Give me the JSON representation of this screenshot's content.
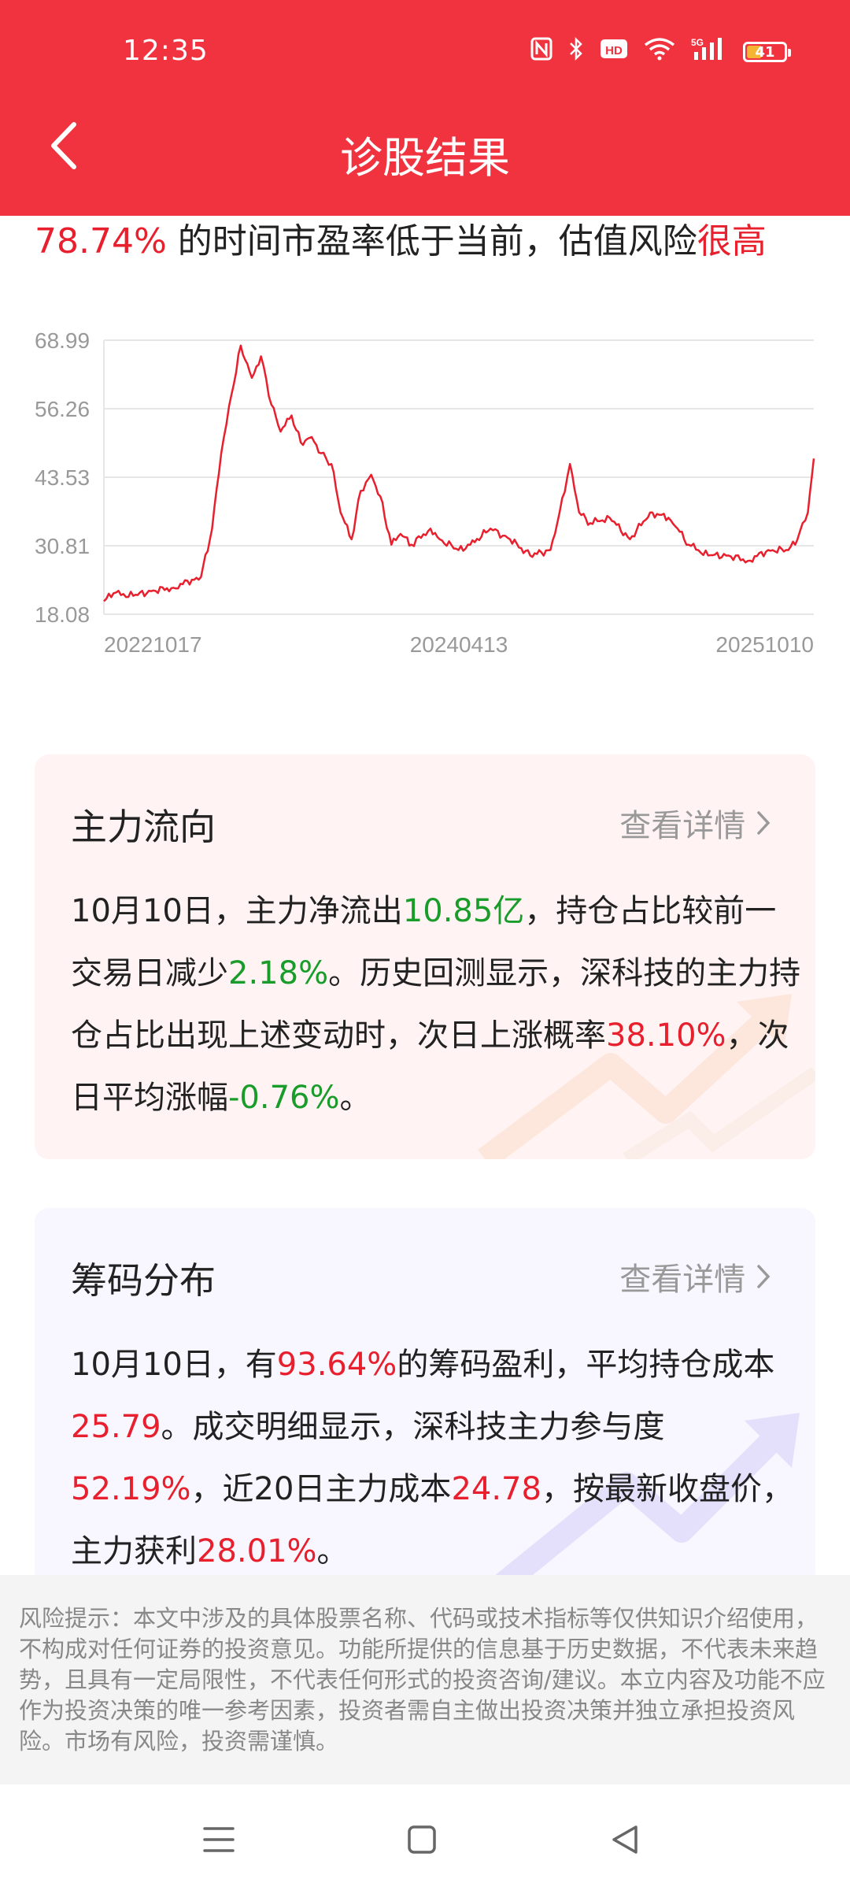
{
  "status_bar": {
    "time": "12:35",
    "icons": [
      "nfc-icon",
      "bluetooth-icon",
      "hd-icon",
      "wifi-icon",
      "5g-signal-icon",
      "battery-icon"
    ],
    "hd_label": "HD",
    "network_label": "5G",
    "battery_level": "41",
    "battery_fraction": 0.41,
    "battery_color": "#f5b431"
  },
  "header": {
    "title": "诊股结果",
    "background_color": "#f0333f"
  },
  "summary": {
    "percent": "78.74%",
    "text": " 的时间市盈率低于当前，估值风险",
    "risk_level": "很高"
  },
  "chart_data": {
    "type": "line",
    "yticks": [
      "68.99",
      "56.26",
      "43.53",
      "30.81",
      "18.08"
    ],
    "ylim": [
      18.08,
      68.99
    ],
    "xticks": [
      "20221017",
      "20240413",
      "20251010"
    ],
    "grid": true,
    "line_color": "#e8202e",
    "series": [
      {
        "x": [
          "20221017",
          "20221101",
          "20221201",
          "20230101",
          "20230201",
          "20230301",
          "20230315",
          "20230401",
          "20230415",
          "20230501",
          "20230515",
          "20230601",
          "20230615",
          "20230701",
          "20230715",
          "20230801",
          "20230815",
          "20230901",
          "20230915",
          "20231001",
          "20231015",
          "20231101",
          "20231115",
          "20231201",
          "20231215",
          "20240101",
          "20240115",
          "20240201",
          "20240301",
          "20240315",
          "20240413",
          "20240501",
          "20240601",
          "20240701",
          "20240801",
          "20240901",
          "20240915",
          "20241001",
          "20241015",
          "20241101",
          "20241201",
          "20250101",
          "20250201",
          "20250301",
          "20250315",
          "20250401",
          "20250501",
          "20250601",
          "20250701",
          "20250801",
          "20250901",
          "20250915",
          "20251001",
          "20251010"
        ],
        "y": [
          20.5,
          22,
          21.5,
          22.5,
          23,
          24.5,
          25,
          34,
          48,
          59,
          68,
          62,
          66,
          57,
          52,
          55,
          50,
          51,
          48,
          46,
          37,
          32,
          41,
          44,
          40,
          31,
          33,
          31,
          34,
          32,
          30,
          31,
          34,
          32,
          29,
          30,
          37,
          46,
          37,
          35,
          36,
          32,
          37,
          36,
          34,
          31,
          29,
          29,
          28,
          30,
          30,
          32,
          37,
          47
        ]
      }
    ]
  },
  "main_flow_card": {
    "title": "主力流向",
    "link_label": "查看详情",
    "background_color": "#fff4f3",
    "segments": [
      {
        "text": "10月10日，主力净流出",
        "color": "default"
      },
      {
        "text": "10.85亿",
        "color": "green"
      },
      {
        "text": "，持仓占比较前一交易日减少",
        "color": "default"
      },
      {
        "text": "2.18%",
        "color": "green"
      },
      {
        "text": "。历史回测显示，深科技的主力持仓占比出现上述变动时，次日上涨概率",
        "color": "default"
      },
      {
        "text": "38.10%",
        "color": "red"
      },
      {
        "text": "，次日平均涨幅",
        "color": "default"
      },
      {
        "text": "-0.76%",
        "color": "green"
      },
      {
        "text": "。",
        "color": "default"
      }
    ]
  },
  "chips_card": {
    "title": "筹码分布",
    "link_label": "查看详情",
    "background_color": "#f8f6ff",
    "segments": [
      {
        "text": "10月10日，有",
        "color": "default"
      },
      {
        "text": "93.64%",
        "color": "red"
      },
      {
        "text": "的筹码盈利，平均持仓成本",
        "color": "default"
      },
      {
        "text": "25.79",
        "color": "red"
      },
      {
        "text": "。成交明细显示，深科技主力参与度",
        "color": "default"
      },
      {
        "text": "52.19%",
        "color": "red"
      },
      {
        "text": "，近20日主力成本",
        "color": "default"
      },
      {
        "text": "24.78",
        "color": "red"
      },
      {
        "text": "，按最新收盘价，主力获利",
        "color": "default"
      },
      {
        "text": "28.01%",
        "color": "red"
      },
      {
        "text": "。",
        "color": "default"
      }
    ]
  },
  "disclaimer": {
    "text": "风险提示：本文中涉及的具体股票名称、代码或技术指标等仅供知识介绍使用，不构成对任何证券的投资意见。功能所提供的信息基于历史数据，不代表未来趋势，且具有一定局限性，不代表任何形式的投资咨询/建议。本立内容及功能不应作为投资决策的唯一参考因素，投资者需自主做出投资决策并独立承担投资风险。市场有风险，投资需谨慎。"
  },
  "nav_bar": {
    "buttons": [
      "menu-icon",
      "home-icon",
      "back-triangle-icon"
    ]
  },
  "colors": {
    "red": "#e8202e",
    "green": "#1a9c2a",
    "accent": "#f0333f"
  }
}
